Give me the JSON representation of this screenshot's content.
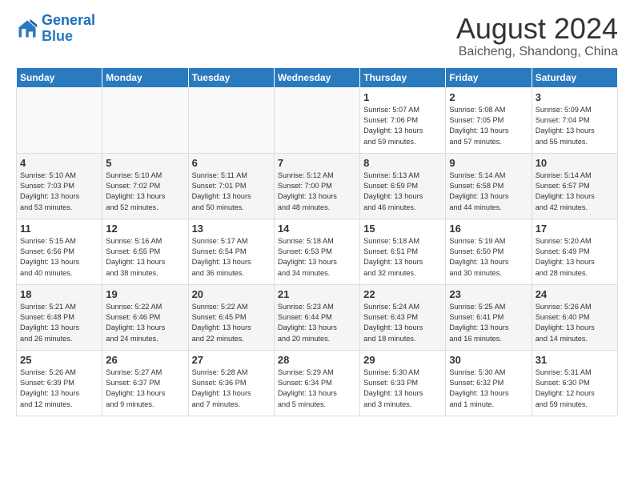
{
  "logo": {
    "line1": "General",
    "line2": "Blue"
  },
  "title": "August 2024",
  "location": "Baicheng, Shandong, China",
  "headers": [
    "Sunday",
    "Monday",
    "Tuesday",
    "Wednesday",
    "Thursday",
    "Friday",
    "Saturday"
  ],
  "weeks": [
    [
      {
        "day": "",
        "info": ""
      },
      {
        "day": "",
        "info": ""
      },
      {
        "day": "",
        "info": ""
      },
      {
        "day": "",
        "info": ""
      },
      {
        "day": "1",
        "info": "Sunrise: 5:07 AM\nSunset: 7:06 PM\nDaylight: 13 hours\nand 59 minutes."
      },
      {
        "day": "2",
        "info": "Sunrise: 5:08 AM\nSunset: 7:05 PM\nDaylight: 13 hours\nand 57 minutes."
      },
      {
        "day": "3",
        "info": "Sunrise: 5:09 AM\nSunset: 7:04 PM\nDaylight: 13 hours\nand 55 minutes."
      }
    ],
    [
      {
        "day": "4",
        "info": "Sunrise: 5:10 AM\nSunset: 7:03 PM\nDaylight: 13 hours\nand 53 minutes."
      },
      {
        "day": "5",
        "info": "Sunrise: 5:10 AM\nSunset: 7:02 PM\nDaylight: 13 hours\nand 52 minutes."
      },
      {
        "day": "6",
        "info": "Sunrise: 5:11 AM\nSunset: 7:01 PM\nDaylight: 13 hours\nand 50 minutes."
      },
      {
        "day": "7",
        "info": "Sunrise: 5:12 AM\nSunset: 7:00 PM\nDaylight: 13 hours\nand 48 minutes."
      },
      {
        "day": "8",
        "info": "Sunrise: 5:13 AM\nSunset: 6:59 PM\nDaylight: 13 hours\nand 46 minutes."
      },
      {
        "day": "9",
        "info": "Sunrise: 5:14 AM\nSunset: 6:58 PM\nDaylight: 13 hours\nand 44 minutes."
      },
      {
        "day": "10",
        "info": "Sunrise: 5:14 AM\nSunset: 6:57 PM\nDaylight: 13 hours\nand 42 minutes."
      }
    ],
    [
      {
        "day": "11",
        "info": "Sunrise: 5:15 AM\nSunset: 6:56 PM\nDaylight: 13 hours\nand 40 minutes."
      },
      {
        "day": "12",
        "info": "Sunrise: 5:16 AM\nSunset: 6:55 PM\nDaylight: 13 hours\nand 38 minutes."
      },
      {
        "day": "13",
        "info": "Sunrise: 5:17 AM\nSunset: 6:54 PM\nDaylight: 13 hours\nand 36 minutes."
      },
      {
        "day": "14",
        "info": "Sunrise: 5:18 AM\nSunset: 6:53 PM\nDaylight: 13 hours\nand 34 minutes."
      },
      {
        "day": "15",
        "info": "Sunrise: 5:18 AM\nSunset: 6:51 PM\nDaylight: 13 hours\nand 32 minutes."
      },
      {
        "day": "16",
        "info": "Sunrise: 5:19 AM\nSunset: 6:50 PM\nDaylight: 13 hours\nand 30 minutes."
      },
      {
        "day": "17",
        "info": "Sunrise: 5:20 AM\nSunset: 6:49 PM\nDaylight: 13 hours\nand 28 minutes."
      }
    ],
    [
      {
        "day": "18",
        "info": "Sunrise: 5:21 AM\nSunset: 6:48 PM\nDaylight: 13 hours\nand 26 minutes."
      },
      {
        "day": "19",
        "info": "Sunrise: 5:22 AM\nSunset: 6:46 PM\nDaylight: 13 hours\nand 24 minutes."
      },
      {
        "day": "20",
        "info": "Sunrise: 5:22 AM\nSunset: 6:45 PM\nDaylight: 13 hours\nand 22 minutes."
      },
      {
        "day": "21",
        "info": "Sunrise: 5:23 AM\nSunset: 6:44 PM\nDaylight: 13 hours\nand 20 minutes."
      },
      {
        "day": "22",
        "info": "Sunrise: 5:24 AM\nSunset: 6:43 PM\nDaylight: 13 hours\nand 18 minutes."
      },
      {
        "day": "23",
        "info": "Sunrise: 5:25 AM\nSunset: 6:41 PM\nDaylight: 13 hours\nand 16 minutes."
      },
      {
        "day": "24",
        "info": "Sunrise: 5:26 AM\nSunset: 6:40 PM\nDaylight: 13 hours\nand 14 minutes."
      }
    ],
    [
      {
        "day": "25",
        "info": "Sunrise: 5:26 AM\nSunset: 6:39 PM\nDaylight: 13 hours\nand 12 minutes."
      },
      {
        "day": "26",
        "info": "Sunrise: 5:27 AM\nSunset: 6:37 PM\nDaylight: 13 hours\nand 9 minutes."
      },
      {
        "day": "27",
        "info": "Sunrise: 5:28 AM\nSunset: 6:36 PM\nDaylight: 13 hours\nand 7 minutes."
      },
      {
        "day": "28",
        "info": "Sunrise: 5:29 AM\nSunset: 6:34 PM\nDaylight: 13 hours\nand 5 minutes."
      },
      {
        "day": "29",
        "info": "Sunrise: 5:30 AM\nSunset: 6:33 PM\nDaylight: 13 hours\nand 3 minutes."
      },
      {
        "day": "30",
        "info": "Sunrise: 5:30 AM\nSunset: 6:32 PM\nDaylight: 13 hours\nand 1 minute."
      },
      {
        "day": "31",
        "info": "Sunrise: 5:31 AM\nSunset: 6:30 PM\nDaylight: 12 hours\nand 59 minutes."
      }
    ]
  ]
}
